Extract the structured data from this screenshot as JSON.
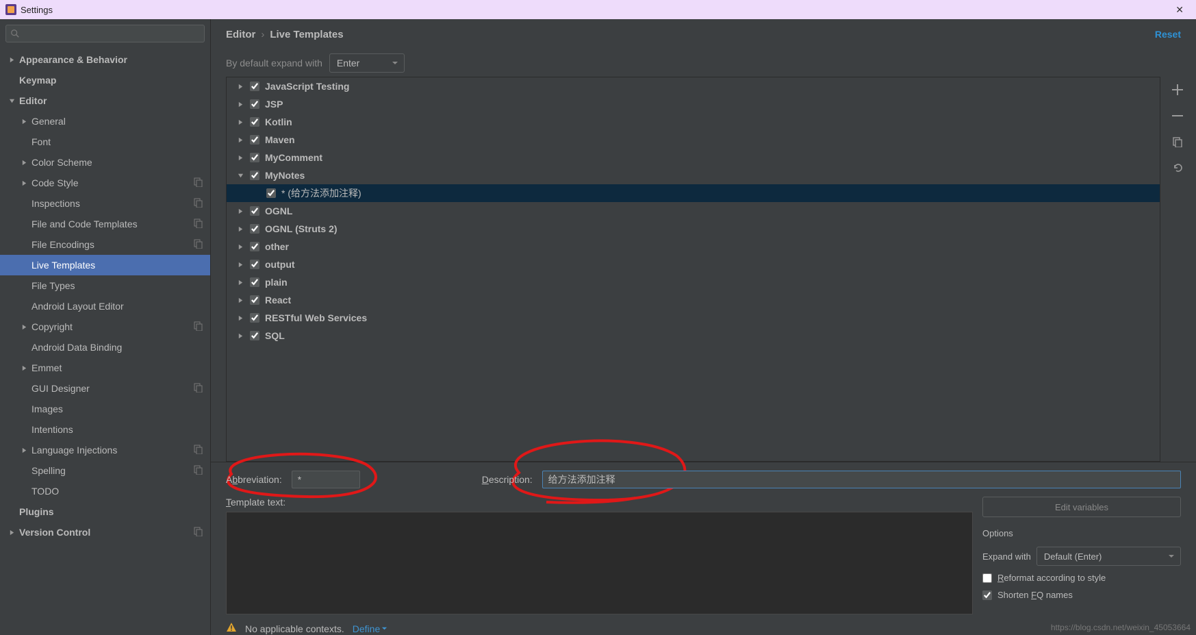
{
  "window": {
    "title": "Settings"
  },
  "breadcrumb": {
    "parent": "Editor",
    "current": "Live Templates"
  },
  "reset_link": "Reset",
  "expand": {
    "label": "By default expand with",
    "value": "Enter"
  },
  "sidebar": {
    "items": [
      {
        "label": "Appearance & Behavior",
        "bold": true,
        "arrow": "right",
        "lvl": 0
      },
      {
        "label": "Keymap",
        "bold": true,
        "arrow": "",
        "lvl": 0
      },
      {
        "label": "Editor",
        "bold": true,
        "arrow": "down",
        "lvl": 0
      },
      {
        "label": "General",
        "arrow": "right",
        "lvl": 1
      },
      {
        "label": "Font",
        "arrow": "",
        "lvl": 1
      },
      {
        "label": "Color Scheme",
        "arrow": "right",
        "lvl": 1
      },
      {
        "label": "Code Style",
        "arrow": "right",
        "lvl": 1,
        "icon": true
      },
      {
        "label": "Inspections",
        "arrow": "",
        "lvl": 1,
        "icon": true
      },
      {
        "label": "File and Code Templates",
        "arrow": "",
        "lvl": 1,
        "icon": true
      },
      {
        "label": "File Encodings",
        "arrow": "",
        "lvl": 1,
        "icon": true
      },
      {
        "label": "Live Templates",
        "arrow": "",
        "lvl": 1,
        "selected": true
      },
      {
        "label": "File Types",
        "arrow": "",
        "lvl": 1
      },
      {
        "label": "Android Layout Editor",
        "arrow": "",
        "lvl": 1
      },
      {
        "label": "Copyright",
        "arrow": "right",
        "lvl": 1,
        "icon": true
      },
      {
        "label": "Android Data Binding",
        "arrow": "",
        "lvl": 1
      },
      {
        "label": "Emmet",
        "arrow": "right",
        "lvl": 1
      },
      {
        "label": "GUI Designer",
        "arrow": "",
        "lvl": 1,
        "icon": true
      },
      {
        "label": "Images",
        "arrow": "",
        "lvl": 1
      },
      {
        "label": "Intentions",
        "arrow": "",
        "lvl": 1
      },
      {
        "label": "Language Injections",
        "arrow": "right",
        "lvl": 1,
        "icon": true
      },
      {
        "label": "Spelling",
        "arrow": "",
        "lvl": 1,
        "icon": true
      },
      {
        "label": "TODO",
        "arrow": "",
        "lvl": 1
      },
      {
        "label": "Plugins",
        "bold": true,
        "arrow": "",
        "lvl": 0
      },
      {
        "label": "Version Control",
        "bold": true,
        "arrow": "right",
        "lvl": 0,
        "icon": true
      }
    ]
  },
  "templates": {
    "groups": [
      {
        "label": "JavaScript Testing",
        "arrow": "right"
      },
      {
        "label": "JSP",
        "arrow": "right"
      },
      {
        "label": "Kotlin",
        "arrow": "right"
      },
      {
        "label": "Maven",
        "arrow": "right"
      },
      {
        "label": "MyComment",
        "arrow": "right"
      },
      {
        "label": "MyNotes",
        "arrow": "down",
        "children": [
          {
            "label": "* (给方法添加注释)",
            "selected": true
          }
        ]
      },
      {
        "label": "OGNL",
        "arrow": "right"
      },
      {
        "label": "OGNL (Struts 2)",
        "arrow": "right"
      },
      {
        "label": "other",
        "arrow": "right"
      },
      {
        "label": "output",
        "arrow": "right"
      },
      {
        "label": "plain",
        "arrow": "right"
      },
      {
        "label": "React",
        "arrow": "right"
      },
      {
        "label": "RESTful Web Services",
        "arrow": "right"
      },
      {
        "label": "SQL",
        "arrow": "right"
      }
    ]
  },
  "editor": {
    "abbrev_label_pre": "A",
    "abbrev_label_ul": "b",
    "abbrev_label_post": "breviation:",
    "abbrev_value": "*",
    "desc_label_pre": "",
    "desc_label_ul": "D",
    "desc_label_post": "escription:",
    "desc_value": "给方法添加注释",
    "template_label_ul": "T",
    "template_label_post": "emplate text:",
    "template_value": "",
    "edit_vars_btn": "Edit variables",
    "options_title": "Options",
    "expand_with_label": "Expand with",
    "expand_with_value": "Default (Enter)",
    "reformat_pre": "",
    "reformat_ul": "R",
    "reformat_post": "eformat according to style",
    "shorten_pre": "Shorten ",
    "shorten_ul": "F",
    "shorten_mid": "Q",
    "shorten_post": " names",
    "context_msg": "No applicable contexts.",
    "define_link": "Define"
  },
  "watermark": "https://blog.csdn.net/weixin_45053664"
}
